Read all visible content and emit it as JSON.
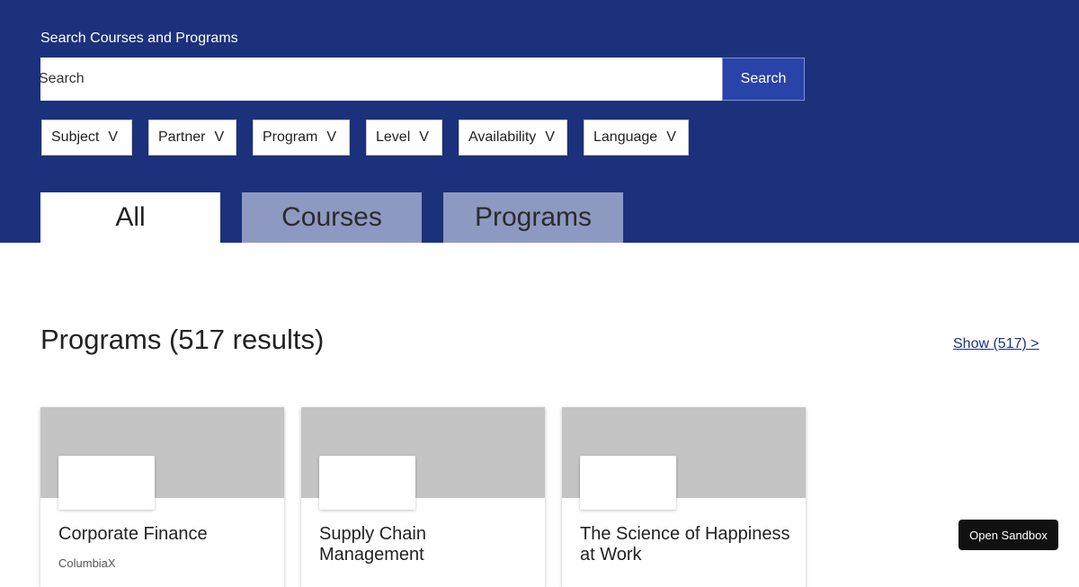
{
  "search": {
    "label": "Search Courses and Programs",
    "placeholder": "Search",
    "button_label": "Search"
  },
  "filters": [
    {
      "label": "Subject",
      "chevron": "V"
    },
    {
      "label": "Partner",
      "chevron": "V"
    },
    {
      "label": "Program",
      "chevron": "V"
    },
    {
      "label": "Level",
      "chevron": "V"
    },
    {
      "label": "Availability",
      "chevron": "V"
    },
    {
      "label": "Language",
      "chevron": "V"
    }
  ],
  "tabs": [
    {
      "label": "All",
      "active": true
    },
    {
      "label": "Courses",
      "active": false
    },
    {
      "label": "Programs",
      "active": false
    }
  ],
  "results": {
    "title": "Programs (517 results)",
    "show_link": "Show (517) >"
  },
  "cards": [
    {
      "title": "Corporate Finance",
      "org": "ColumbiaX"
    },
    {
      "title": "Supply Chain Management",
      "org": ""
    },
    {
      "title": "The Science of Happiness at Work",
      "org": ""
    }
  ],
  "sandbox": {
    "label": "Open Sandbox"
  },
  "colors": {
    "header_bg": "#1b317b",
    "search_button": "#2a43a8",
    "inactive_tab": "#8d99c1",
    "card_banner": "#c4c4c4"
  }
}
